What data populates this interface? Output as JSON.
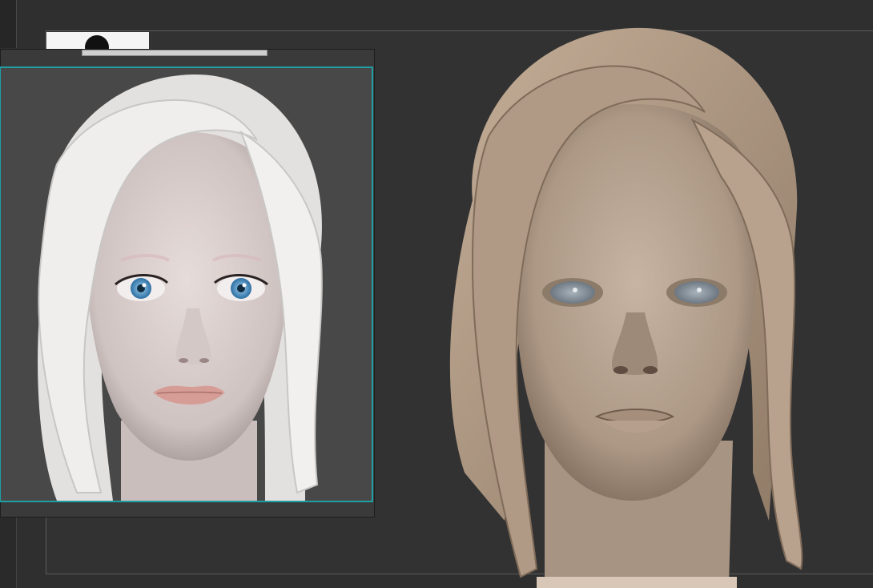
{
  "app": {
    "background": "#2f2f2f",
    "accent_border": "#1f9ea4"
  },
  "reference_panel": {
    "icon": "reference-image-icon",
    "skin_color": "#dcd2d0",
    "hair_color": "#ecebea",
    "eye_color": "#4f8fbf",
    "lip_color": "#d39a94"
  },
  "sculpt_viewport": {
    "icon": "sculpt-model-icon",
    "clay_color": "#b9a592",
    "hair_color": "#b49e89",
    "eye_color": "#7d8a96"
  }
}
